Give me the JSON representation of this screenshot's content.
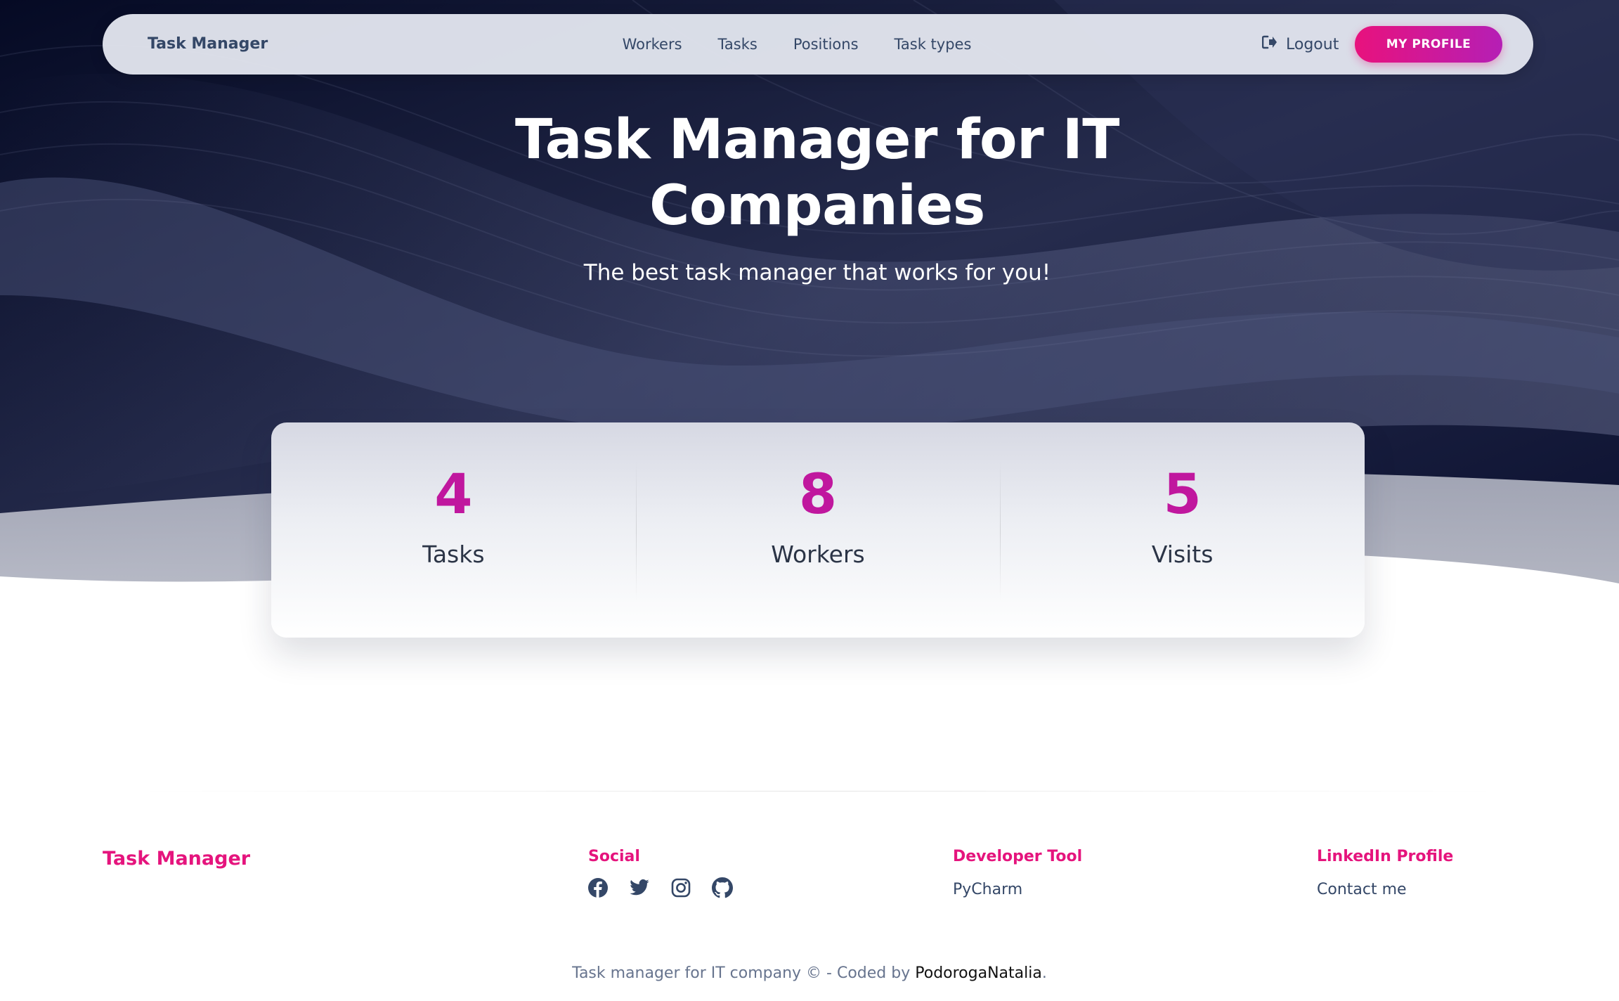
{
  "navbar": {
    "brand": "Task Manager",
    "links": [
      "Workers",
      "Tasks",
      "Positions",
      "Task types"
    ],
    "logout_label": "Logout",
    "profile_label": "MY PROFILE"
  },
  "hero": {
    "title_line1": "Task Manager for IT",
    "title_line2": "Companies",
    "subtitle": "The best task manager that works for you!"
  },
  "stats": [
    {
      "value": "4",
      "label": "Tasks"
    },
    {
      "value": "8",
      "label": "Workers"
    },
    {
      "value": "5",
      "label": "Visits"
    }
  ],
  "footer": {
    "brand": "Task Manager",
    "social_heading": "Social",
    "social_icons": [
      "facebook-icon",
      "twitter-icon",
      "instagram-icon",
      "github-icon"
    ],
    "dev_heading": "Developer Tool",
    "dev_link": "PyCharm",
    "linkedin_heading": "LinkedIn Profile",
    "linkedin_link": "Contact me",
    "copyright_text": "Task manager for IT company © - Coded by",
    "author": "PodorogaNatalia",
    "period": "."
  },
  "colors": {
    "accent": "#e5147d",
    "stat_number": "#c0179e",
    "hero_bg": "#0b1030"
  }
}
